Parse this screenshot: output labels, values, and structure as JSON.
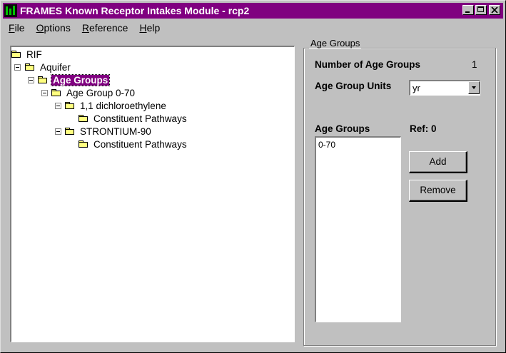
{
  "window": {
    "title": "FRAMES Known Receptor Intakes Module - rcp2"
  },
  "menu": [
    {
      "label": "File",
      "underline": "F",
      "rest": "ile"
    },
    {
      "label": "Options",
      "underline": "O",
      "rest": "ptions"
    },
    {
      "label": "Reference",
      "underline": "R",
      "rest": "eference"
    },
    {
      "label": "Help",
      "underline": "H",
      "rest": "elp"
    }
  ],
  "tree": {
    "nodes": [
      {
        "label": "RIF",
        "expander": ""
      },
      {
        "label": "Aquifer",
        "expander": "minus"
      },
      {
        "label": "Age Groups",
        "expander": "minus",
        "selected": true
      },
      {
        "label": "Age Group 0-70",
        "expander": "minus"
      },
      {
        "label": "1,1 dichloroethylene",
        "expander": "minus"
      },
      {
        "label": "Constituent Pathways",
        "expander": ""
      },
      {
        "label": "STRONTIUM-90",
        "expander": "minus"
      },
      {
        "label": "Constituent Pathways",
        "expander": ""
      }
    ]
  },
  "panel": {
    "group_label": "Age Groups",
    "num_age_groups_label": "Number of Age Groups",
    "num_age_groups_value": "1",
    "units_label": "Age Group Units",
    "units_value": "yr",
    "list_label": "Age Groups",
    "ref_label": "Ref: 0",
    "list_items": [
      "0-70"
    ],
    "add_button": "Add",
    "remove_button": "Remove"
  },
  "colors": {
    "titlebar": "#800080",
    "selection": "#800080",
    "face": "#c0c0c0"
  }
}
